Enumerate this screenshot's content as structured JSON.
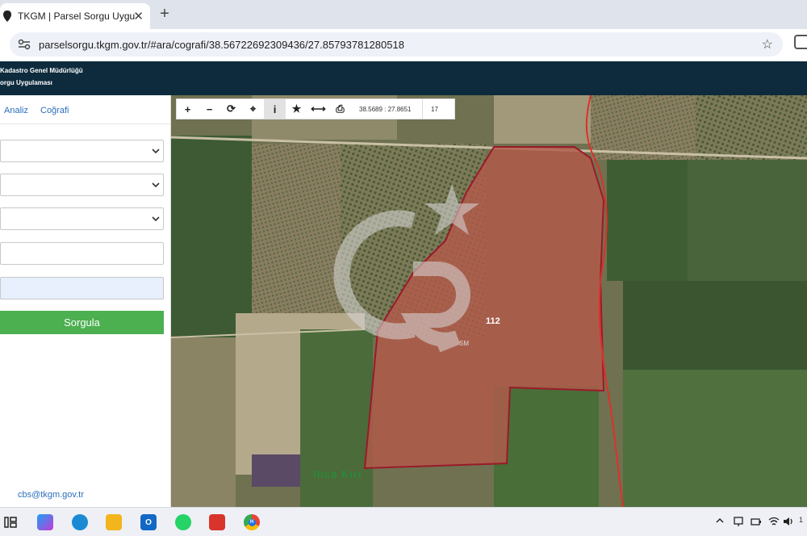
{
  "browser": {
    "tab_title": "TKGM | Parsel Sorgu Uygulaması",
    "tab_close": "✕",
    "new_tab": "+",
    "url": "parselsorgu.tkgm.gov.tr/#ara/cografi/38.56722692309436/27.85793781280518",
    "star": "☆"
  },
  "header": {
    "line1": "Kadastro Genel Müdürlüğü",
    "line2": "orgu Uygulaması"
  },
  "sidebar": {
    "tabs": [
      "Analiz",
      "Coğrafi"
    ],
    "search_button": "Sorgula",
    "email": "cbs@tkgm.gov.tr"
  },
  "map": {
    "toolbar": {
      "zoom_in": "+",
      "zoom_out": "−",
      "refresh": "⟳",
      "locate": "⌖",
      "info": "i",
      "favorite": "★",
      "measure": "⟷",
      "print": "⎙",
      "coordinates": "38.5689 : 27.8651",
      "zoom_level": "17"
    },
    "parcel_number": "112",
    "watermark_text": "SM",
    "place_label": "Ilıca Kırı"
  },
  "taskbar": {
    "outlook_letter": "O",
    "chrome_badge": "H",
    "clock_fragment": "1"
  },
  "colors": {
    "header_bg": "#0d2b3d",
    "button_green": "#4caf50",
    "parcel_fill": "#b25a4a",
    "parcel_border": "#9a1a2a"
  }
}
